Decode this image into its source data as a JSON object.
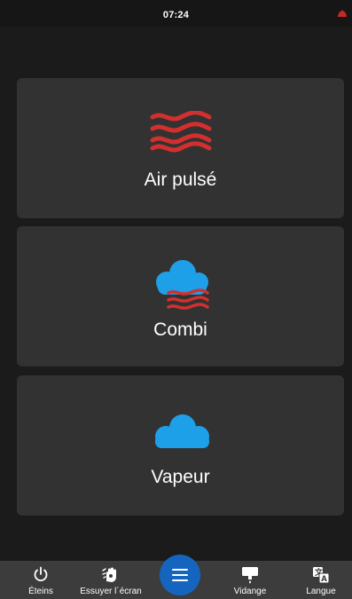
{
  "status_bar": {
    "time": "07:24"
  },
  "modes": [
    {
      "label": "Air pulsé",
      "icon": "hot-air-waves-icon"
    },
    {
      "label": "Combi",
      "icon": "cloud-with-heat-waves-icon"
    },
    {
      "label": "Vapeur",
      "icon": "steam-cloud-icon"
    }
  ],
  "bottom_nav": {
    "items": [
      {
        "label": "Éteins",
        "icon": "power-icon"
      },
      {
        "label": "Essuyer l´écran",
        "icon": "hand-wipe-icon"
      },
      {
        "label": "Vidange",
        "icon": "drain-icon"
      },
      {
        "label": "Langue",
        "icon": "translate-icon"
      }
    ],
    "menu_icon": "hamburger-menu-icon"
  },
  "colors": {
    "background": "#1b1b1b",
    "card": "#323232",
    "heat_red": "#d32f2f",
    "steam_blue": "#1ea0e8",
    "accent_blue": "#1565c0",
    "nav_bar": "#3c3c3c",
    "alert_red": "#c62828"
  }
}
